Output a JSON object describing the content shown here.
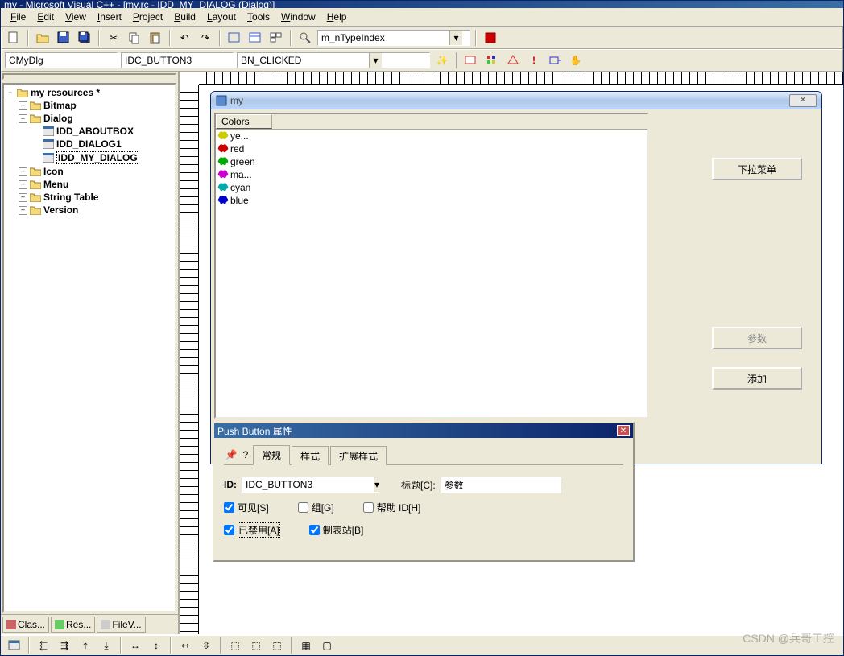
{
  "title": "my - Microsoft Visual C++ - [my.rc - IDD_MY_DIALOG (Dialog)]",
  "menus": [
    "File",
    "Edit",
    "View",
    "Insert",
    "Project",
    "Build",
    "Layout",
    "Tools",
    "Window",
    "Help"
  ],
  "toolbar2": {
    "combo_value": "m_nTypeIndex"
  },
  "toolbar3": {
    "class_combo": "CMyDlg",
    "id_combo": "IDC_BUTTON3",
    "msg_combo": "BN_CLICKED"
  },
  "tree": {
    "root": "my resources *",
    "items": [
      {
        "label": "Bitmap",
        "exp": "+",
        "indent": 1,
        "icon": "folder"
      },
      {
        "label": "Dialog",
        "exp": "-",
        "indent": 1,
        "icon": "folder"
      },
      {
        "label": "IDD_ABOUTBOX",
        "indent": 2,
        "icon": "dlg"
      },
      {
        "label": "IDD_DIALOG1",
        "indent": 2,
        "icon": "dlg"
      },
      {
        "label": "IDD_MY_DIALOG",
        "indent": 2,
        "icon": "dlg",
        "selected": true
      },
      {
        "label": "Icon",
        "exp": "+",
        "indent": 1,
        "icon": "folder"
      },
      {
        "label": "Menu",
        "exp": "+",
        "indent": 1,
        "icon": "folder"
      },
      {
        "label": "String Table",
        "exp": "+",
        "indent": 1,
        "icon": "folder"
      },
      {
        "label": "Version",
        "exp": "+",
        "indent": 1,
        "icon": "folder"
      }
    ]
  },
  "bottomTabs": [
    "Clas...",
    "Res...",
    "FileV..."
  ],
  "designDialog": {
    "title": "my",
    "list_header": "Colors",
    "rows": [
      {
        "label": "ye...",
        "color": "#cccc00"
      },
      {
        "label": "red",
        "color": "#cc0000"
      },
      {
        "label": "green",
        "color": "#00aa00"
      },
      {
        "label": "ma...",
        "color": "#cc00cc"
      },
      {
        "label": "cyan",
        "color": "#00aaaa"
      },
      {
        "label": "blue",
        "color": "#0000cc"
      }
    ],
    "btn_dropdown": "下拉菜单",
    "btn_param": "参数",
    "btn_add": "添加"
  },
  "propDialog": {
    "title": "Push Button 属性",
    "tabs": [
      "常规",
      "样式",
      "扩展样式"
    ],
    "id_label": "ID:",
    "id_value": "IDC_BUTTON3",
    "caption_label": "标题[C]:",
    "caption_value": "参数",
    "chk_visible": "可见[S]",
    "chk_group": "组[G]",
    "chk_helpid": "帮助 ID[H]",
    "chk_disabled": "已禁用[A]",
    "chk_tabstop": "制表站[B]"
  },
  "watermark": "CSDN @兵哥工控"
}
